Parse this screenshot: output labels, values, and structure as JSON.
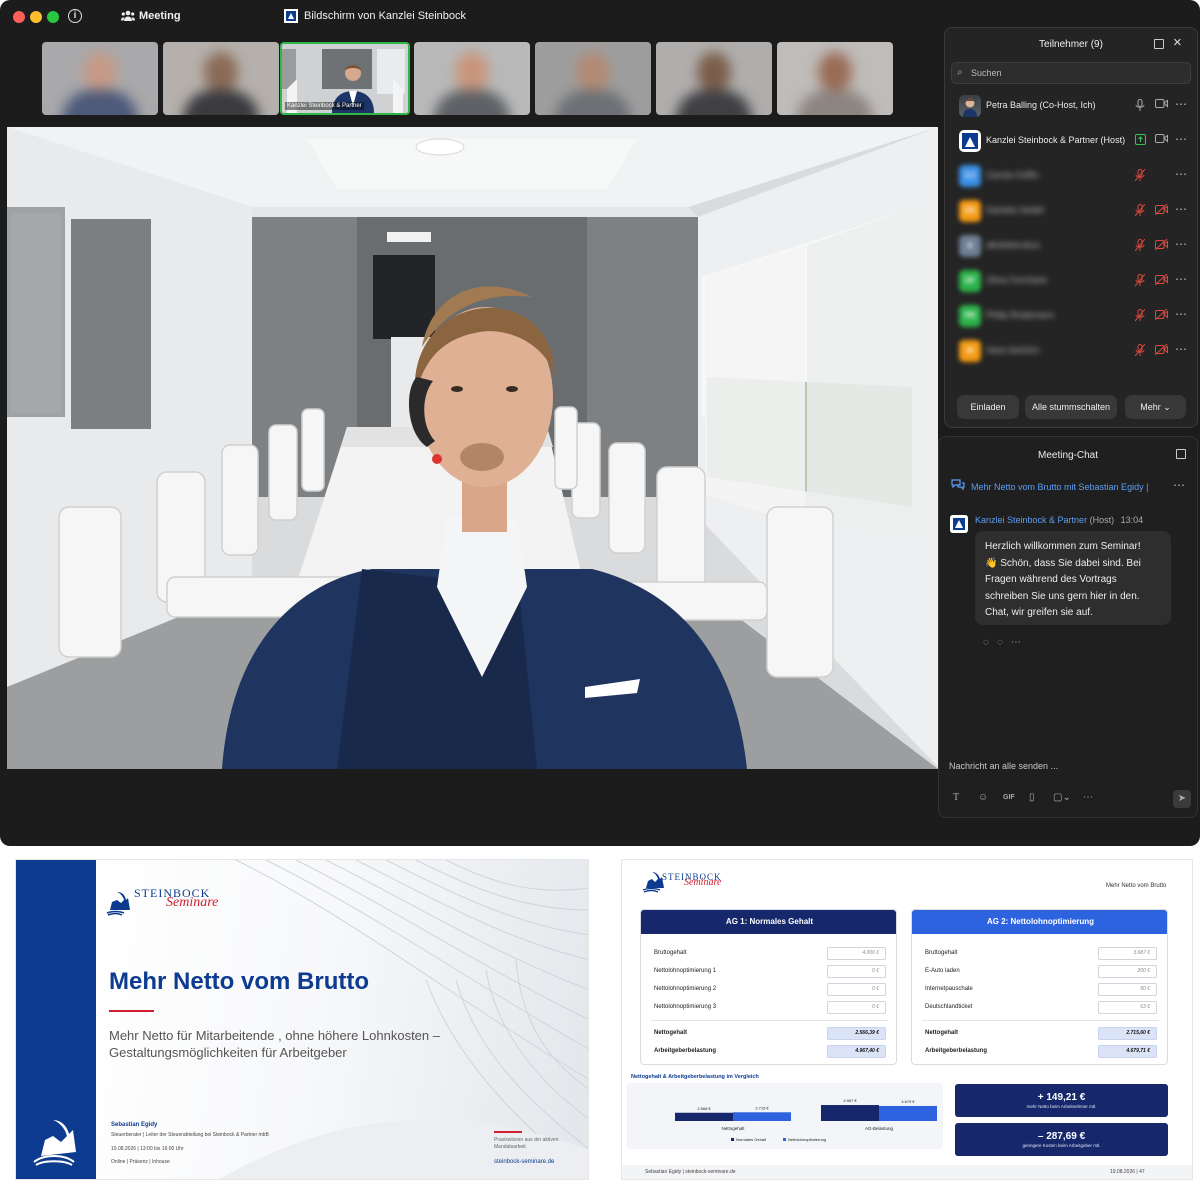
{
  "titlebar": {
    "meeting_label": "Meeting",
    "share_label": "Bildschirm von Kanzlei Steinbock"
  },
  "thumbnails": {
    "active_label": "Kanzlei Steinbock & Partner"
  },
  "participants": {
    "title": "Teilnehmer (9)",
    "search_placeholder": "Suchen",
    "list": [
      {
        "name": "Petra Balling (Co-Host, Ich)",
        "initials": "",
        "color": "#8d7a6a",
        "blurred": false,
        "mic": "on",
        "cam": "on"
      },
      {
        "name": "Kanzlei Steinbock & Partner (Host)",
        "initials": "",
        "color": "#ffffff",
        "blurred": false,
        "mic": "sharing",
        "cam": "on"
      },
      {
        "name": "Carola Griffin",
        "initials": "CJ",
        "color": "#3b8fe5",
        "blurred": true,
        "mic": "muted",
        "cam": "none"
      },
      {
        "name": "Daniela Seidel",
        "initials": "DS",
        "color": "#f39a14",
        "blurred": true,
        "mic": "muted",
        "cam": "off"
      },
      {
        "name": "allrahbernkus",
        "initials": "A",
        "color": "#6f7f95",
        "blurred": true,
        "mic": "muted",
        "cam": "off"
      },
      {
        "name": "Olina Fernhack",
        "initials": "OF",
        "color": "#2cb34a",
        "blurred": true,
        "mic": "muted",
        "cam": "off"
      },
      {
        "name": "Philip Rodemann",
        "initials": "PR",
        "color": "#2cb34a",
        "blurred": true,
        "mic": "muted",
        "cam": "off"
      },
      {
        "name": "Sara Iserlohn",
        "initials": "SI",
        "color": "#f39a14",
        "blurred": true,
        "mic": "muted",
        "cam": "off"
      }
    ],
    "buttons": {
      "invite": "Einladen",
      "mute_all": "Alle stummschalten",
      "more": "Mehr"
    }
  },
  "chat": {
    "title": "Meeting-Chat",
    "thread": "Mehr Netto vom Brutto mit Sebastian Egidy |",
    "sender": "Kanzlei Steinbock & Partner",
    "sender_role": "(Host)",
    "time": "13:04",
    "message_lines": [
      "Herzlich willkommen zum Seminar!",
      "👋 Schön, dass Sie dabei sind. Bei",
      "Fragen während des Vortrags",
      "schreiben Sie uns gern hier in den.",
      "Chat, wir greifen sie auf."
    ],
    "input_placeholder": "Nachricht an alle senden ...",
    "gif_label": "GIF"
  },
  "slide1": {
    "logo_text": "STEINBOCK",
    "logo_script": "Seminare",
    "title": "Mehr Netto vom Brutto",
    "subtitle1": "Mehr Netto für Mitarbeitende , ohne höhere Lohnkosten –",
    "subtitle2": "Gestaltungsmöglichkeiten für Arbeitgeber",
    "speaker": "Sebastian Egidy",
    "role": "Steuerberater  |  Leiter der Steuerabteilung bei Steinbock & Partner mbB",
    "date": "19.08.2026 | 13:00 bis 16:00 Uhr",
    "formats": "Online  |  Präsenz  |  Inhouse",
    "note": "Praxiswissen aus der aktiven Mandatsarbeit.",
    "url": "steinbock-seminare.de"
  },
  "slide2": {
    "logo_text": "STEINBOCK",
    "logo_script": "Seminare",
    "topic": "Mehr Netto vom Brutto",
    "card1": {
      "title": "AG 1: Normales Gehalt",
      "rows": [
        {
          "label": "Bruttogehalt",
          "value": "4.000 €"
        },
        {
          "label": "Nettolohnoptimierung 1",
          "value": "0 €"
        },
        {
          "label": "Nettolohnoptimierung 2",
          "value": "0 €"
        },
        {
          "label": "Nettolohnoptimierung 3",
          "value": "0 €"
        }
      ],
      "totals": [
        {
          "label": "Nettogehalt",
          "value": "2.566,39 €"
        },
        {
          "label": "Arbeitgeberbelastung",
          "value": "4.967,40 €"
        }
      ]
    },
    "card2": {
      "title": "AG 2: Nettolohnoptimierung",
      "rows": [
        {
          "label": "Bruttogehalt",
          "value": "3.687 €"
        },
        {
          "label": "E-Auto laden",
          "value": "200 €"
        },
        {
          "label": "Internetpauschale",
          "value": "50 €"
        },
        {
          "label": "Deutschlandticket",
          "value": "63 €"
        }
      ],
      "totals": [
        {
          "label": "Nettogehalt",
          "value": "2.715,60 €"
        },
        {
          "label": "Arbeitgeberbelastung",
          "value": "4.679,71 €"
        }
      ]
    },
    "comparison_title": "Nettogehalt & Arbeitgeberbelastung im Vergleich",
    "result1": {
      "value": "+ 149,21 €",
      "caption": "mehr Netto beim Arbeitnehmer mtl."
    },
    "result2": {
      "value": "– 287,69 €",
      "caption": "geringere Kosten beim Arbeitgeber mtl."
    },
    "footer_left": "Sebastian Egidy | steinbock-seminare.de",
    "footer_right": "19.08.2026  |  47"
  },
  "chart_data": {
    "type": "bar",
    "categories": [
      "Nettogehalt",
      "AG-Belastung"
    ],
    "series": [
      {
        "name": "Normales Gehalt",
        "values": [
          2566,
          4967
        ]
      },
      {
        "name": "Nettolohnoptimierung",
        "values": [
          2715,
          4679
        ]
      }
    ],
    "value_labels": [
      [
        "2.566 €",
        "4.967 €"
      ],
      [
        "2.715 €",
        "4.679 €"
      ]
    ],
    "colors": [
      "#16286b",
      "#2e63e0"
    ]
  }
}
